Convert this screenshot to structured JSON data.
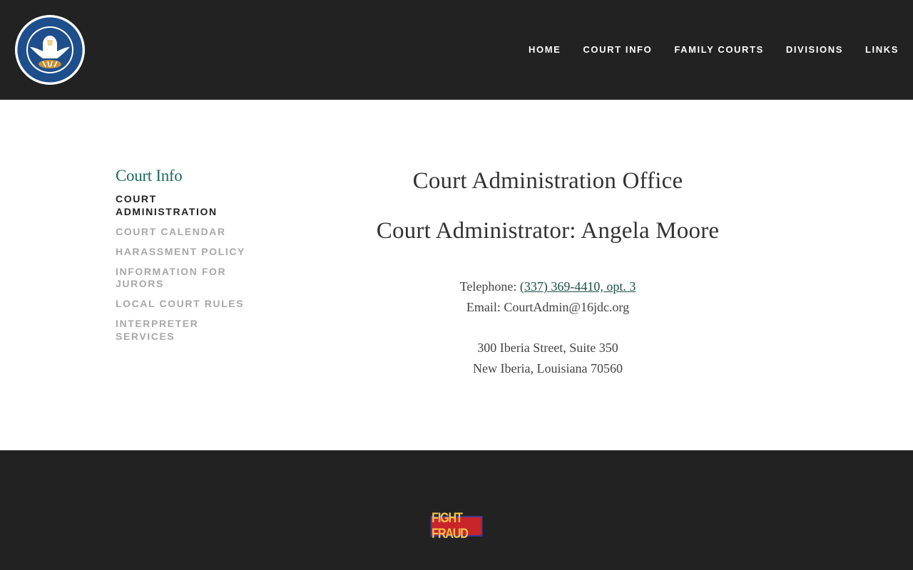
{
  "header": {
    "logo_alt": "State of Louisiana 16th Judicial District Court seal",
    "nav": [
      {
        "label": "HOME"
      },
      {
        "label": "COURT INFO"
      },
      {
        "label": "FAMILY COURTS"
      },
      {
        "label": "DIVISIONS"
      },
      {
        "label": "LINKS"
      }
    ]
  },
  "sidebar": {
    "title": "Court Info",
    "items": [
      {
        "label": "COURT ADMINISTRATION",
        "active": true
      },
      {
        "label": "COURT CALENDAR"
      },
      {
        "label": "HARASSMENT POLICY"
      },
      {
        "label": "INFORMATION FOR JURORS"
      },
      {
        "label": "LOCAL COURT RULES"
      },
      {
        "label": "INTERPRETER SERVICES"
      }
    ]
  },
  "content": {
    "heading": "Court Administration Office",
    "subheading": "Court Administrator: Angela Moore",
    "telephone_label": "Telephone: ",
    "telephone_value": "(337) 369-4410, opt. 3",
    "email_text": "Email: CourtAdmin@16jdc.org",
    "address_line1": "300 Iberia Street, Suite 350",
    "address_line2": "New Iberia, Louisiana 70560"
  },
  "footer": {
    "badge_label": "FIGHT FRAUD"
  },
  "colors": {
    "header_bg": "#222222",
    "accent_green": "#1d6b5d",
    "link_color": "#1d4e47",
    "inactive_nav": "#a8a8a8"
  }
}
